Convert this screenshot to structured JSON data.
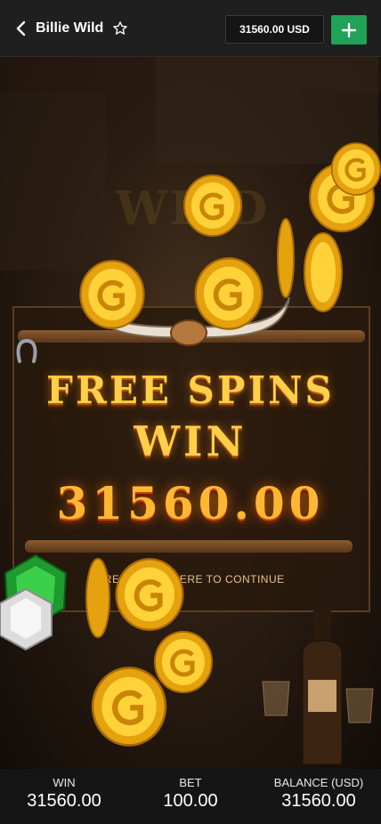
{
  "header": {
    "game_title": "Billie Wild",
    "balance": "31560.00 USD",
    "icons": {
      "back": "chevron-left-icon",
      "favorite": "star-outline-icon",
      "deposit": "plus-icon"
    }
  },
  "game": {
    "banner_line1": "FREE SPINS",
    "banner_line2": "WIN",
    "win_amount": "31560.00",
    "continue_prompt": "PRESS ANYWHERE TO CONTINUE",
    "background_logo": "WILD"
  },
  "footer": {
    "win_label": "WIN",
    "win_value": "31560.00",
    "bet_label": "BET",
    "bet_value": "100.00",
    "balance_label": "BALANCE (USD)",
    "balance_value": "31560.00"
  },
  "colors": {
    "accent_green": "#20a356",
    "gold": "#ffcf4a"
  }
}
